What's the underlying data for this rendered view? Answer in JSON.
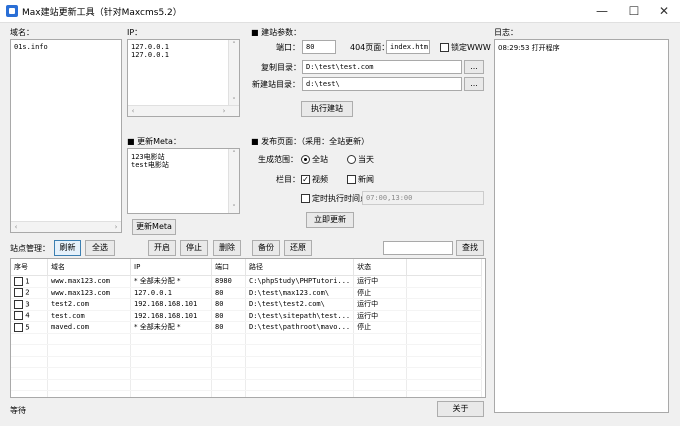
{
  "window": {
    "title": "Max建站更新工具（针对Maxcms5.2）",
    "minimize": "—",
    "maximize": "☐",
    "close": "✕"
  },
  "domains": {
    "label": "域名：",
    "items": [
      "01s.info"
    ]
  },
  "ips": {
    "label": "IP：",
    "items": [
      "127.0.0.1",
      "127.0.0.1"
    ]
  },
  "meta": {
    "label": "■ 更新Meta：",
    "lines": [
      "123电影站",
      "test电影站"
    ],
    "button": "更新Meta"
  },
  "build": {
    "label": "■ 建站参数：",
    "port_label": "端口：",
    "port_value": "80",
    "page404_label": "404页面：",
    "page404_value": "index.htm",
    "lock_www_label": "锁定WWW",
    "copy_dir_label": "复制目录：",
    "copy_dir_value": "D:\\test\\test.com",
    "new_dir_label": "新建站目录：",
    "new_dir_value": "d:\\test\\",
    "browse_label": "...",
    "run_button": "执行建站"
  },
  "publish": {
    "label": "■ 发布页面：（采用：全站更新）",
    "scope_label": "生成范围：",
    "scope_all": "全站",
    "scope_day": "当天",
    "column_label": "栏目：",
    "col_video": "视频",
    "col_news": "新闻",
    "timer_label": "定时执行时间点：",
    "timer_value": "07:00,13:00",
    "update_button": "立即更新"
  },
  "site_mgmt": {
    "label": "站点管理：",
    "buttons": {
      "refresh": "刷新",
      "select_all": "全选",
      "start": "开启",
      "stop": "停止",
      "delete": "删除",
      "backup": "备份",
      "restore": "还原",
      "search": "查找"
    },
    "search_value": ""
  },
  "table": {
    "headers": [
      "序号",
      "域名",
      "IP",
      "端口",
      "路径",
      "状态"
    ],
    "rows": [
      [
        "1",
        "www.max123.com",
        "* 全部未分配 *",
        "8980",
        "C:\\phpStudy\\PHPTutori...",
        "运行中"
      ],
      [
        "2",
        "www.max123.com",
        "127.0.0.1",
        "80",
        "D:\\test\\max123.com\\",
        "停止"
      ],
      [
        "3",
        "test2.com",
        "192.168.168.101",
        "80",
        "D:\\test\\test2.com\\",
        "运行中"
      ],
      [
        "4",
        "test.com",
        "192.168.168.101",
        "80",
        "D:\\test\\sitepath\\test...",
        "运行中"
      ],
      [
        "5",
        "maved.com",
        "* 全部未分配 *",
        "80",
        "D:\\test\\pathroot\\mavo...",
        "停止"
      ]
    ]
  },
  "log": {
    "label": "日志：",
    "lines": [
      "08:29:53 打开程序"
    ]
  },
  "status": {
    "text": "等待",
    "about_button": "关于"
  }
}
